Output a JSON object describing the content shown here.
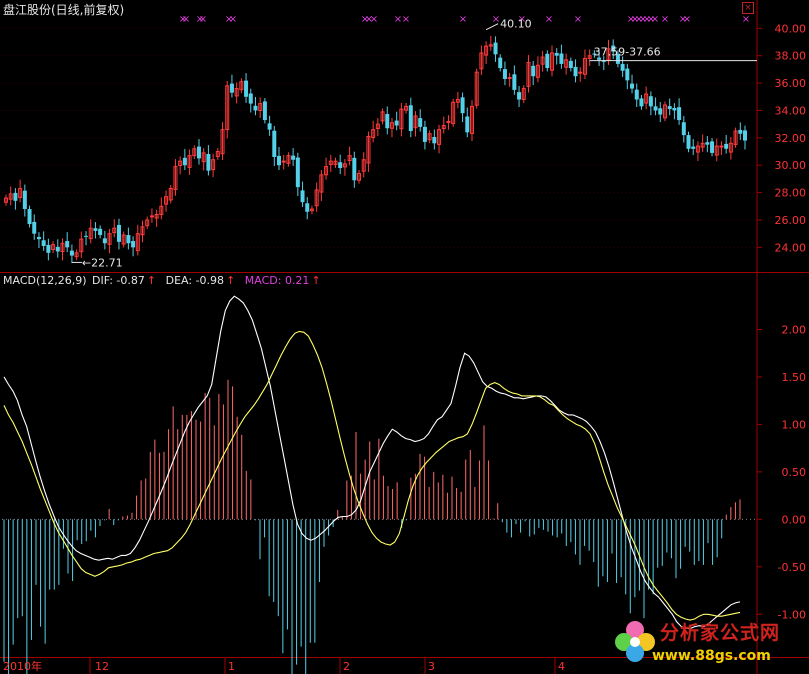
{
  "title": "盘江股份(日线,前复权)",
  "indicator": {
    "name": "MACD(12,26,9)",
    "dif_label": "DIF: -0.87",
    "dea_label": "DEA: -0.98",
    "macd_label": "MACD: 0.21"
  },
  "colors": {
    "up": "#ff3b3b",
    "down": "#54d0e8",
    "dif": "#ffffff",
    "dea": "#ffff66",
    "macd_label": "#e040e0",
    "grid": "#a00000",
    "axis_text": "#ff3333"
  },
  "chart_data": [
    {
      "type": "candlestick",
      "title": "盘江股份(日线,前复权)",
      "ylim": [
        22.2,
        40.9
      ],
      "y_ticks": [
        24.0,
        26.0,
        28.0,
        30.0,
        32.0,
        34.0,
        36.0,
        38.0,
        40.0
      ],
      "y_tick_labels": [
        "24.00",
        "26.00",
        "28.00",
        "30.00",
        "32.00",
        "34.00",
        "36.00",
        "38.00",
        "40.00"
      ],
      "x_labels": [
        "2010年",
        "12",
        "1",
        "2",
        "3",
        "4"
      ],
      "annotations": {
        "low_label": "22.71",
        "high_label": "40.10",
        "range_label": "37.59-37.66"
      },
      "close": [
        27.6,
        27.9,
        27.4,
        28.3,
        26.8,
        25.7,
        25.0,
        24.6,
        24.1,
        23.6,
        24.2,
        23.7,
        24.3,
        24.0,
        23.4,
        23.6,
        24.6,
        24.8,
        25.4,
        25.2,
        24.9,
        24.3,
        25.0,
        25.4,
        24.4,
        24.9,
        24.3,
        24.0,
        25.0,
        25.5,
        26.0,
        26.3,
        26.4,
        27.0,
        27.7,
        28.3,
        29.9,
        30.3,
        30.0,
        30.7,
        31.2,
        30.5,
        30.9,
        29.6,
        30.4,
        31.0,
        32.6,
        35.8,
        35.3,
        35.6,
        36.1,
        35.0,
        34.5,
        34.0,
        34.5,
        33.3,
        32.6,
        30.6,
        30.0,
        30.3,
        30.7,
        30.4,
        28.4,
        27.3,
        26.6,
        26.8,
        28.2,
        29.3,
        29.9,
        30.3,
        30.3,
        29.8,
        30.1,
        30.7,
        28.9,
        29.4,
        30.4,
        32.1,
        32.6,
        33.0,
        33.9,
        32.7,
        33.1,
        32.9,
        34.1,
        34.3,
        32.5,
        33.6,
        32.8,
        31.7,
        32.3,
        31.6,
        32.6,
        32.9,
        33.2,
        34.6,
        34.8,
        33.8,
        32.4,
        34.3,
        36.8,
        38.2,
        38.7,
        38.8,
        38.1,
        37.1,
        36.3,
        36.4,
        35.5,
        34.8,
        35.6,
        37.5,
        36.5,
        37.3,
        37.9,
        37.1,
        38.2,
        38.0,
        37.4,
        37.7,
        37.1,
        36.5,
        36.8,
        37.8,
        38.0,
        38.1,
        37.7,
        37.6,
        38.5,
        38.3,
        37.4,
        36.9,
        36.2,
        35.6,
        34.8,
        34.3,
        35.2,
        34.3,
        34.0,
        33.7,
        34.4,
        34.1,
        34.0,
        33.3,
        32.2,
        31.2,
        31.2,
        31.4,
        31.6,
        31.5,
        30.9,
        31.4,
        31.4,
        31.2,
        31.6,
        32.5,
        32.3,
        31.8
      ],
      "change_markers": [
        "red",
        "red",
        "cyan",
        "red",
        "red",
        "cyan",
        "red",
        "cyan",
        "cyan",
        "cyan",
        "red",
        "cyan",
        "red",
        "red",
        "cyan",
        "red",
        "cyan",
        "red",
        "red",
        "cyan",
        "cyan",
        "cyan",
        "red",
        "red",
        "cyan",
        "red",
        "cyan",
        "cyan",
        "red",
        "red",
        "red",
        "red",
        "red",
        "red",
        "red",
        "red",
        "red",
        "red",
        "cyan",
        "red",
        "red",
        "cyan",
        "cyan",
        "cyan",
        "red",
        "red",
        "red",
        "red",
        "cyan",
        "red",
        "red",
        "cyan",
        "cyan",
        "cyan",
        "red",
        "cyan",
        "cyan",
        "cyan",
        "cyan",
        "red",
        "red",
        "cyan",
        "cyan",
        "cyan",
        "cyan",
        "red",
        "red",
        "red",
        "red",
        "red",
        "cyan",
        "cyan",
        "red",
        "red",
        "cyan",
        "red",
        "red",
        "red",
        "red",
        "red",
        "red",
        "cyan",
        "red",
        "cyan",
        "red",
        "red",
        "cyan",
        "red",
        "cyan",
        "cyan",
        "red",
        "cyan",
        "red",
        "red",
        "red",
        "red",
        "red",
        "cyan",
        "cyan",
        "red",
        "red",
        "red",
        "red",
        "red",
        "cyan",
        "cyan",
        "cyan",
        "red",
        "cyan",
        "cyan",
        "red",
        "red",
        "cyan",
        "red",
        "red",
        "cyan",
        "red",
        "cyan",
        "cyan",
        "red",
        "cyan",
        "cyan",
        "red",
        "red",
        "red",
        "red",
        "cyan",
        "cyan",
        "red",
        "cyan",
        "cyan",
        "cyan",
        "cyan",
        "cyan",
        "cyan",
        "cyan",
        "red",
        "cyan",
        "cyan",
        "cyan",
        "red",
        "cyan",
        "cyan",
        "cyan",
        "cyan",
        "cyan",
        "cyan",
        "red",
        "red",
        "cyan",
        "cyan",
        "red",
        "cyan",
        "red",
        "red",
        "red",
        "cyan",
        "cyan"
      ]
    },
    {
      "type": "macd",
      "title": "MACD(12,26,9)",
      "ylim": [
        -1.45,
        2.5
      ],
      "y_ticks": [
        2.0,
        1.5,
        1.0,
        0.5,
        0.0,
        -0.5,
        -1.0
      ],
      "y_tick_labels": [
        "2.00",
        "1.50",
        "1.00",
        "0.50",
        "0.00",
        "-0.50",
        "-1.00"
      ],
      "series": [
        {
          "name": "DIF",
          "values": [
            1.5,
            1.42,
            1.35,
            1.25,
            1.1,
            0.98,
            0.8,
            0.62,
            0.45,
            0.3,
            0.16,
            0.04,
            -0.07,
            -0.15,
            -0.22,
            -0.28,
            -0.33,
            -0.36,
            -0.38,
            -0.4,
            -0.42,
            -0.43,
            -0.42,
            -0.41,
            -0.42,
            -0.4,
            -0.38,
            -0.38,
            -0.36,
            -0.3,
            -0.22,
            -0.12,
            -0.02,
            0.09,
            0.2,
            0.31,
            0.43,
            0.56,
            0.68,
            0.8,
            0.92,
            1.02,
            1.1,
            1.18,
            1.24,
            1.3,
            1.42,
            1.7,
            1.98,
            2.2,
            2.3,
            2.35,
            2.32,
            2.28,
            2.2,
            2.1,
            1.95,
            1.8,
            1.6,
            1.4,
            1.15,
            0.9,
            0.65,
            0.4,
            0.15,
            -0.05,
            -0.15,
            -0.2,
            -0.22,
            -0.2,
            -0.16,
            -0.12,
            -0.07,
            -0.02,
            0.02,
            0.03,
            0.03,
            0.05,
            0.1,
            0.2,
            0.35,
            0.5,
            0.6,
            0.7,
            0.8,
            0.88,
            0.95,
            0.92,
            0.88,
            0.85,
            0.84,
            0.82,
            0.83,
            0.85,
            0.9,
            0.98,
            1.05,
            1.08,
            1.15,
            1.22,
            1.4,
            1.6,
            1.75,
            1.72,
            1.65,
            1.55,
            1.45,
            1.4,
            1.38,
            1.35,
            1.33,
            1.32,
            1.3,
            1.28,
            1.28,
            1.27,
            1.28,
            1.29,
            1.3,
            1.3,
            1.29,
            1.25,
            1.2,
            1.15,
            1.12,
            1.1,
            1.1,
            1.08,
            1.06,
            1.03,
            0.98,
            0.92,
            0.82,
            0.7,
            0.55,
            0.38,
            0.2,
            0.02,
            -0.15,
            -0.3,
            -0.42,
            -0.55,
            -0.65,
            -0.72,
            -0.78,
            -0.82,
            -0.88,
            -0.94,
            -1.0,
            -1.08,
            -1.13,
            -1.15,
            -1.15,
            -1.13,
            -1.12,
            -1.13,
            -1.1,
            -1.06,
            -1.02,
            -0.98,
            -0.94,
            -0.9,
            -0.88,
            -0.87
          ]
        },
        {
          "name": "DEA",
          "values": [
            1.2,
            1.1,
            1.02,
            0.92,
            0.82,
            0.7,
            0.58,
            0.45,
            0.32,
            0.2,
            0.08,
            -0.04,
            -0.14,
            -0.22,
            -0.3,
            -0.38,
            -0.45,
            -0.52,
            -0.56,
            -0.58,
            -0.6,
            -0.58,
            -0.55,
            -0.51,
            -0.5,
            -0.49,
            -0.48,
            -0.46,
            -0.45,
            -0.43,
            -0.42,
            -0.4,
            -0.38,
            -0.36,
            -0.35,
            -0.34,
            -0.33,
            -0.3,
            -0.25,
            -0.2,
            -0.14,
            -0.05,
            0.05,
            0.15,
            0.25,
            0.35,
            0.45,
            0.55,
            0.65,
            0.74,
            0.83,
            0.92,
            1.0,
            1.08,
            1.14,
            1.2,
            1.27,
            1.35,
            1.43,
            1.53,
            1.63,
            1.73,
            1.82,
            1.9,
            1.96,
            1.98,
            1.97,
            1.93,
            1.84,
            1.73,
            1.6,
            1.43,
            1.25,
            1.05,
            0.85,
            0.66,
            0.48,
            0.32,
            0.18,
            0.06,
            -0.05,
            -0.14,
            -0.2,
            -0.24,
            -0.26,
            -0.27,
            -0.24,
            -0.15,
            0.02,
            0.2,
            0.35,
            0.46,
            0.54,
            0.6,
            0.65,
            0.7,
            0.74,
            0.78,
            0.82,
            0.84,
            0.86,
            0.87,
            0.9,
            1.0,
            1.12,
            1.25,
            1.38,
            1.42,
            1.44,
            1.42,
            1.38,
            1.35,
            1.33,
            1.32,
            1.3,
            1.3,
            1.3,
            1.3,
            1.29,
            1.26,
            1.22,
            1.2,
            1.15,
            1.1,
            1.06,
            1.03,
            1.0,
            0.98,
            0.95,
            0.9,
            0.8,
            0.65,
            0.5,
            0.36,
            0.24,
            0.12,
            0.02,
            -0.08,
            -0.18,
            -0.28,
            -0.4,
            -0.52,
            -0.62,
            -0.7,
            -0.76,
            -0.82,
            -0.88,
            -0.95,
            -1.0,
            -1.03,
            -1.05,
            -1.06,
            -1.05,
            -1.02,
            -1.0,
            -1.0,
            -1.01,
            -1.02,
            -1.02,
            -1.01,
            -1.0,
            -0.99,
            -0.98
          ]
        },
        {
          "name": "MACD",
          "values": [
            -1.5,
            -1.73,
            -1.32,
            -1.04,
            -1.02,
            -1.74,
            -1.27,
            -0.69,
            -1.13,
            -1.31,
            -0.74,
            -0.74,
            -0.69,
            -0.31,
            -0.57,
            -0.65,
            -0.22,
            -0.26,
            -0.23,
            -0.12,
            -0.19,
            -0.07,
            -0.01,
            0.11,
            -0.06,
            -0.01,
            0.03,
            0.04,
            0.07,
            0.25,
            0.41,
            0.43,
            0.71,
            0.84,
            0.7,
            0.71,
            0.95,
            1.19,
            0.95,
            1.1,
            1.1,
            1.14,
            1.05,
            1.03,
            1.33,
            1.28,
            0.99,
            1.32,
            1.21,
            1.47,
            1.4,
            1.08,
            0.89,
            0.51,
            0.42,
            -0.01,
            -0.42,
            -0.19,
            -0.81,
            -0.87,
            -1.02,
            -1.41,
            -1.16,
            -1.71,
            -1.53,
            -1.34,
            -1.71,
            -1.3,
            -1.3,
            -0.66,
            -0.29,
            -0.17,
            -0.08,
            0.1,
            0.03,
            0.41,
            0.46,
            0.92,
            0.48,
            0.63,
            0.82,
            0.42,
            0.85,
            0.46,
            0.35,
            0.32,
            0.39,
            -0.09,
            -0.01,
            0.44,
            0.48,
            0.69,
            0.66,
            0.34,
            0.5,
            0.39,
            0.47,
            0.28,
            0.45,
            0.33,
            0.29,
            0.63,
            0.73,
            0.34,
            0.62,
            0.99,
            0.62,
            0.01,
            0.17,
            -0.03,
            -0.14,
            -0.19,
            -0.05,
            -0.14,
            -0.02,
            -0.18,
            -0.16,
            -0.09,
            -0.11,
            -0.13,
            -0.17,
            -0.19,
            -0.15,
            -0.28,
            -0.24,
            -0.37,
            -0.48,
            -0.28,
            -0.33,
            -0.45,
            -0.71,
            -0.6,
            -0.66,
            -0.36,
            -0.67,
            -0.61,
            -0.79,
            -0.99,
            -0.82,
            -0.75,
            -1.04,
            -0.74,
            -0.79,
            -0.51,
            -0.49,
            -0.35,
            -0.41,
            -0.62,
            -0.52,
            -0.29,
            -0.34,
            -0.48,
            -0.44,
            -0.48,
            -0.25,
            -0.48,
            -0.4,
            -0.2,
            0.05,
            0.13,
            0.18,
            0.21
          ]
        }
      ],
      "y_unit": ""
    }
  ],
  "watermark": {
    "line1": "分析家公式网",
    "line2": "www.88gs.com"
  },
  "close_icon": "×"
}
